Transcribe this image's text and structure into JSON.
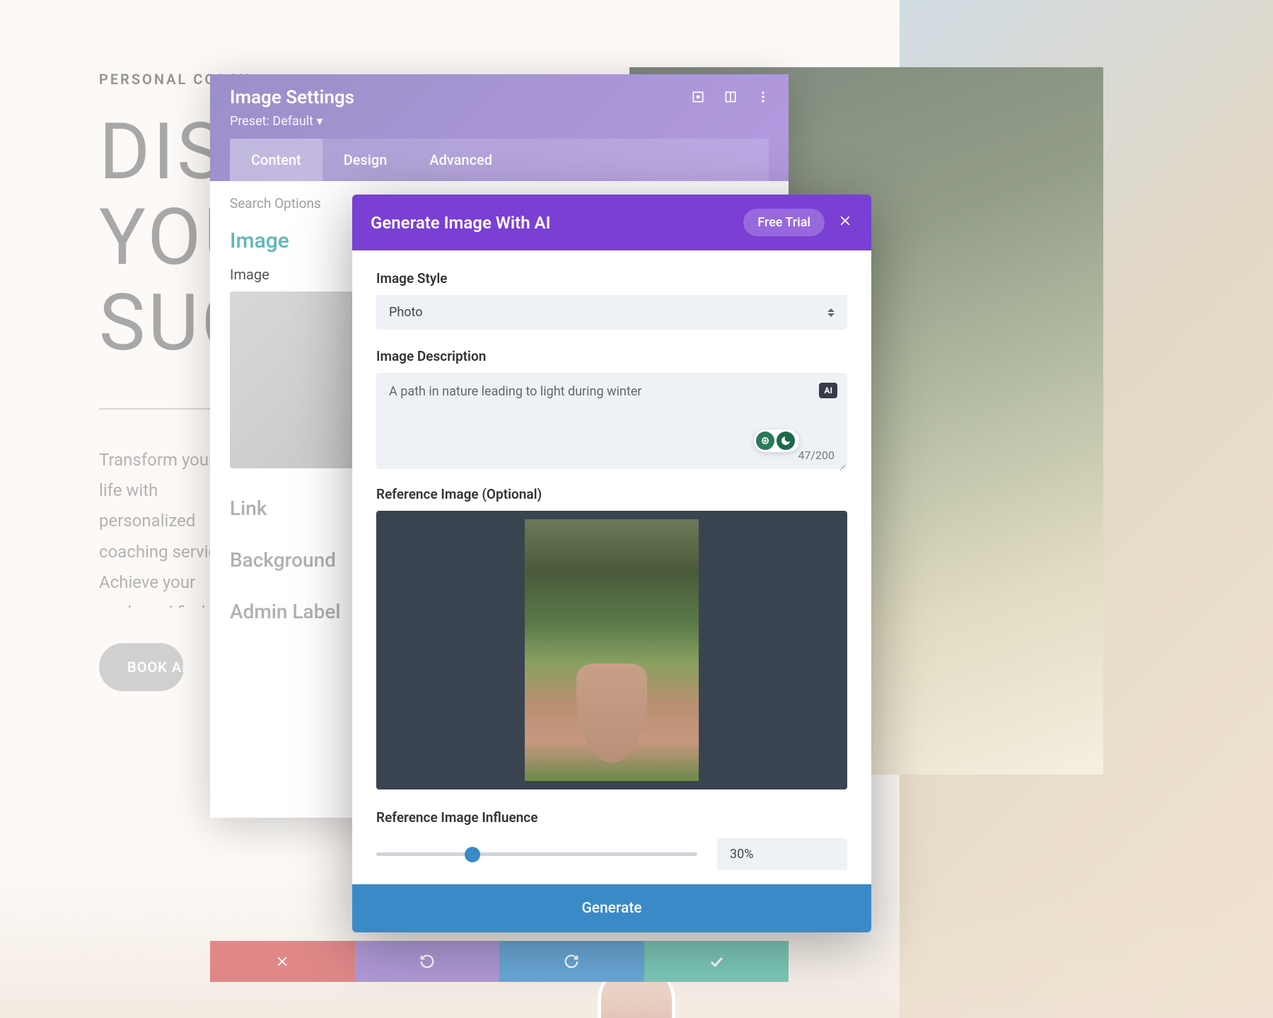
{
  "page": {
    "eyebrow": "PERSONAL COACH",
    "title_line1": "DISCOVER",
    "title_line2": "YOUR",
    "title_line3": "SUCCESS",
    "description": "Transform your life with personalized coaching services. Achieve your goals and find inner peace. Our philosophy centers on mindfulness and balance. Empower yourself to overcome obstacles and unlock your full potential.",
    "cta": "BOOK AN APPOINTMENT"
  },
  "settings": {
    "title": "Image Settings",
    "preset": "Preset: Default ▾",
    "tabs": {
      "content": "Content",
      "design": "Design",
      "advanced": "Advanced"
    },
    "search": "Search Options",
    "image_section": "Image",
    "image_label": "Image",
    "link_section": "Link",
    "background_section": "Background",
    "admin_section": "Admin Label"
  },
  "ai": {
    "title": "Generate Image With AI",
    "free_trial": "Free Trial",
    "style_label": "Image Style",
    "style_value": "Photo",
    "desc_label": "Image Description",
    "desc_value": "A path in nature leading to light during winter",
    "ai_badge": "AI",
    "char_count": "47/200",
    "ref_label": "Reference Image (Optional)",
    "influence_label": "Reference Image Influence",
    "influence_value": "30%",
    "influence_percent": 30,
    "generate": "Generate"
  }
}
